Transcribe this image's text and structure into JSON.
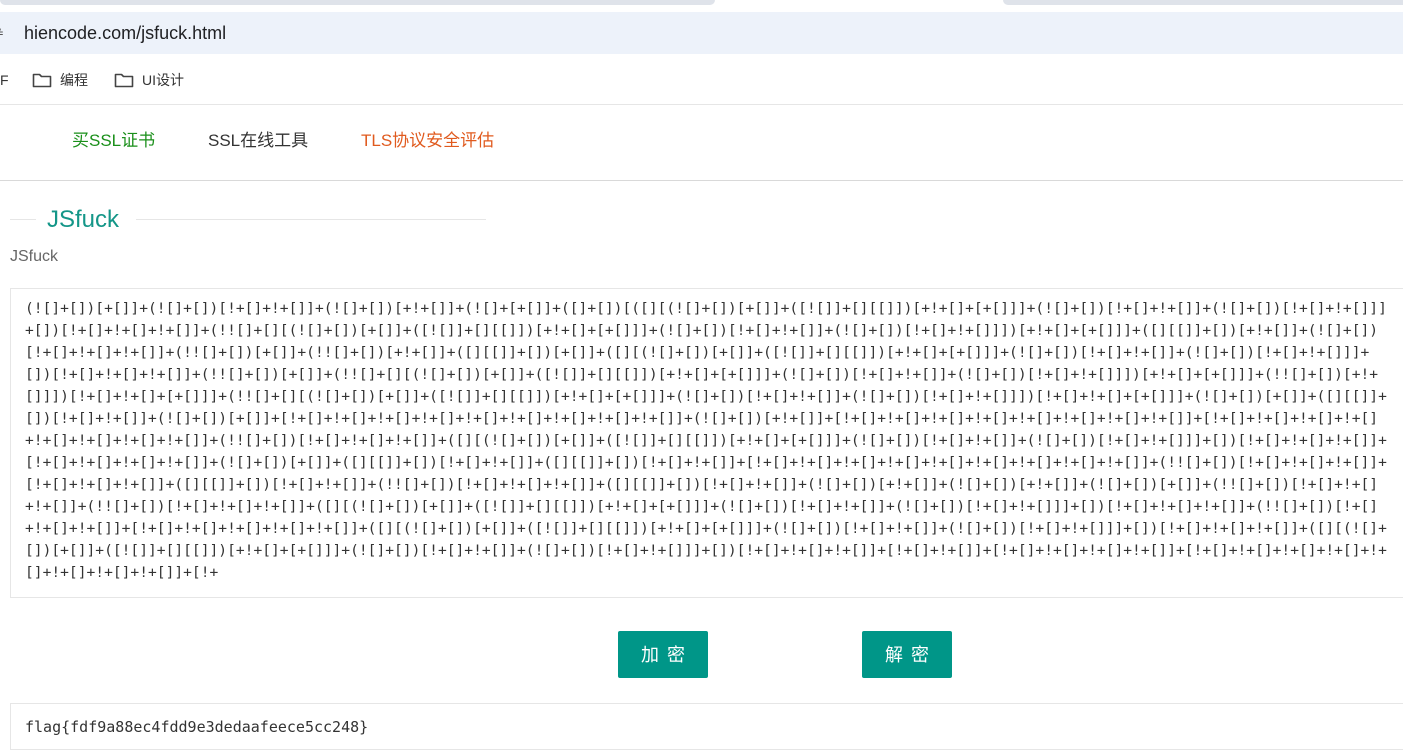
{
  "browser": {
    "url": "hiencode.com/jsfuck.html",
    "site_icon_glyph": "≗"
  },
  "bookmarks": {
    "cut_label": "F",
    "items": [
      {
        "label": "编程",
        "icon": "folder-icon"
      },
      {
        "label": "UI设计",
        "icon": "folder-icon"
      }
    ]
  },
  "nav": {
    "items": [
      {
        "label": "买SSL证书",
        "color": "#1a8f1a"
      },
      {
        "label": "SSL在线工具",
        "color": "#333333"
      },
      {
        "label": "TLS协议安全评估",
        "color": "#e05a1e"
      }
    ]
  },
  "panel": {
    "title": "JSfuck",
    "subtitle": "JSfuck"
  },
  "input": {
    "value": "(![]+[])[+[]]+(![]+[])[!+[]+!+[]]+(![]+[])[+!+[]]+(![]+[+[]]+([]+[])[([][(![]+[])[+[]]+([![]]+[][[]])[+!+[]+[+[]]]+(![]+[])[!+[]+!+[]]+(![]+[])[!+[]+!+[]]]+[])[!+[]+!+[]+!+[]]+(!![]+[][(![]+[])[+[]]+([![]]+[][[]])[+!+[]+[+[]]]+(![]+[])[!+[]+!+[]]+(![]+[])[!+[]+!+[]]])[+!+[]+[+[]]]+([][[]]+[])[+!+[]]+(![]+[])[!+[]+!+[]+!+[]]+(!![]+[])[+[]]+(!![]+[])[+!+[]]+([][[]]+[])[+[]]+([][(![]+[])[+[]]+([![]]+[][[]])[+!+[]+[+[]]]+(![]+[])[!+[]+!+[]]+(![]+[])[!+[]+!+[]]]+[])[!+[]+!+[]+!+[]]+(!![]+[])[+[]]+(!![]+[][(![]+[])[+[]]+([![]]+[][[]])[+!+[]+[+[]]]+(![]+[])[!+[]+!+[]]+(![]+[])[!+[]+!+[]]])[+!+[]+[+[]]]+(!![]+[])[+!+[]]])[!+[]+!+[]+[+[]]]+(!![]+[][(![]+[])[+[]]+([![]]+[][[]])[+!+[]+[+[]]]+(![]+[])[!+[]+!+[]]+(![]+[])[!+[]+!+[]]])[!+[]+!+[]+[+[]]]+(![]+[])[+[]]+([][[]]+[])[!+[]+!+[]]+(![]+[])[+[]]+[!+[]+!+[]+!+[]+!+[]+!+[]+!+[]+!+[]+!+[]+!+[]]+(![]+[])[+!+[]]+[!+[]+!+[]+!+[]+!+[]+!+[]+!+[]+!+[]+!+[]]+[!+[]+!+[]+!+[]+!+[]+!+[]+!+[]+!+[]+!+[]]+(!![]+[])[!+[]+!+[]+!+[]]+([][(![]+[])[+[]]+([![]]+[][[]])[+!+[]+[+[]]]+(![]+[])[!+[]+!+[]]+(![]+[])[!+[]+!+[]]]+[])[!+[]+!+[]+!+[]]+[!+[]+!+[]+!+[]+!+[]]+(![]+[])[+[]]+([][[]]+[])[!+[]+!+[]]+([][[]]+[])[!+[]+!+[]]+[!+[]+!+[]+!+[]+!+[]+!+[]+!+[]+!+[]+!+[]+!+[]]+(!![]+[])[!+[]+!+[]+!+[]]+[!+[]+!+[]+!+[]]+([][[]]+[])[!+[]+!+[]]+(!![]+[])[!+[]+!+[]+!+[]]+([][[]]+[])[!+[]+!+[]]+(![]+[])[+!+[]]+(![]+[])[+!+[]]+(![]+[])[+[]]+(!![]+[])[!+[]+!+[]+!+[]]+(!![]+[])[!+[]+!+[]+!+[]]+([][(![]+[])[+[]]+([![]]+[][[]])[+!+[]+[+[]]]+(![]+[])[!+[]+!+[]]+(![]+[])[!+[]+!+[]]]+[])[!+[]+!+[]+!+[]]+(!![]+[])[!+[]+!+[]+!+[]]+[!+[]+!+[]+!+[]+!+[]+!+[]]+([][(![]+[])[+[]]+([![]]+[][[]])[+!+[]+[+[]]]+(![]+[])[!+[]+!+[]]+(![]+[])[!+[]+!+[]]]+[])[!+[]+!+[]+!+[]]+([][(![]+[])[+[]]+([![]]+[][[]])[+!+[]+[+[]]]+(![]+[])[!+[]+!+[]]+(![]+[])[!+[]+!+[]]]+[])[!+[]+!+[]+!+[]]+[!+[]+!+[]]+[!+[]+!+[]+!+[]+!+[]]+[!+[]+!+[]+!+[]+!+[]+!+[]+!+[]+!+[]+!+[]]+[!+"
  },
  "buttons": {
    "encrypt_label": "加密",
    "decrypt_label": "解密"
  },
  "output": {
    "value": "flag{fdf9a88ec4fdd9e3dedaafeece5cc248}"
  },
  "colors": {
    "accent": "#009688",
    "title": "#149688"
  }
}
